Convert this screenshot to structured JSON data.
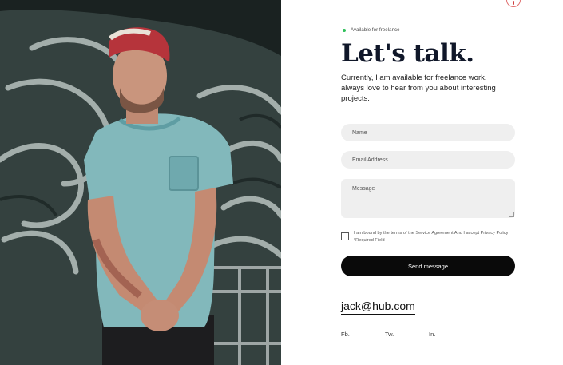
{
  "availability": {
    "label": "Available for freelance",
    "status_color": "#2fbf5a"
  },
  "heading": {
    "title": "Let's talk."
  },
  "intro": {
    "text": "Currently, I am available for freelance work. I always love to hear from you about interesting projects."
  },
  "form": {
    "name_placeholder": "Name",
    "email_placeholder": "Email Address",
    "message_placeholder": "Message",
    "agreement_text": "I am bound by the terms of the Service Agreement And I accept Privacy Policy *Required Field",
    "agreement_checked": false,
    "submit_label": "Send message"
  },
  "contact": {
    "email": "jack@hub.com"
  },
  "social": {
    "facebook": "Fb.",
    "twitter": "Tw.",
    "linkedin": "In."
  },
  "colors": {
    "title": "#101729",
    "button": "#0a0a0a",
    "field_bg": "#efefef"
  },
  "icons": {
    "corner": "circle-arrow-icon"
  }
}
